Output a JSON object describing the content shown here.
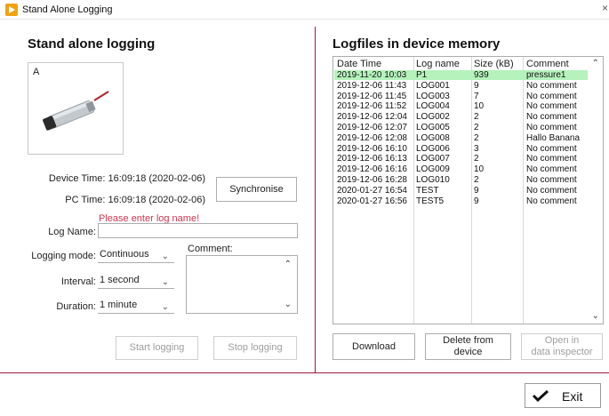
{
  "window": {
    "title": "Stand Alone Logging",
    "close_glyph": "×"
  },
  "left": {
    "heading": "Stand alone logging",
    "image_label": "A",
    "device_time": "Device Time: 16:09:18 (2020-02-06)",
    "pc_time": "PC Time: 16:09:18 (2020-02-06)",
    "sync_button": "Synchronise",
    "warning": "Please enter log name!",
    "log_name_label": "Log Name:",
    "log_name_value": "",
    "logging_mode_label": "Logging mode:",
    "logging_mode_value": "Continuous",
    "comment_label": "Comment:",
    "interval_label": "Interval:",
    "interval_value": "1 second",
    "duration_label": "Duration:",
    "duration_value": "1 minute",
    "start_button": "Start logging",
    "stop_button": "Stop logging"
  },
  "right": {
    "heading": "Logfiles in device memory",
    "columns": [
      "Date Time",
      "Log name",
      "Size (kB)",
      "Comment"
    ],
    "rows": [
      [
        "2019-11-20 10:03",
        "P1",
        "939",
        "pressure1"
      ],
      [
        "2019-12-06 11:43",
        "LOG001",
        "9",
        "No comment"
      ],
      [
        "2019-12-06 11:45",
        "LOG003",
        "7",
        "No comment"
      ],
      [
        "2019-12-06 11:52",
        "LOG004",
        "10",
        "No comment"
      ],
      [
        "2019-12-06 12:04",
        "LOG002",
        "2",
        "No comment"
      ],
      [
        "2019-12-06 12:07",
        "LOG005",
        "2",
        "No comment"
      ],
      [
        "2019-12-06 12:08",
        "LOG008",
        "2",
        "Hallo Banana"
      ],
      [
        "2019-12-06 16:10",
        "LOG006",
        "3",
        "No comment"
      ],
      [
        "2019-12-06 16:13",
        "LOG007",
        "2",
        "No comment"
      ],
      [
        "2019-12-06 16:16",
        "LOG009",
        "10",
        "No comment"
      ],
      [
        "2019-12-06 16:28",
        "LOG010",
        "2",
        "No comment"
      ],
      [
        "2020-01-27 16:54",
        "TEST",
        "9",
        "No comment"
      ],
      [
        "2020-01-27 16:56",
        "TEST5",
        "9",
        "No comment"
      ]
    ],
    "selected_row": 0,
    "download_button": "Download",
    "delete_button_line1": "Delete from",
    "delete_button_line2": "device",
    "open_button_line1": "Open in",
    "open_button_line2": "data inspector"
  },
  "footer": {
    "exit_button": "Exit"
  },
  "colors": {
    "accent_line": "#a3173b",
    "warning": "#d1334f",
    "selected_row": "#b5f2bc",
    "app_icon": "#f2a20e"
  },
  "icons": [
    "app-icon",
    "close-icon",
    "chevron-down-icon",
    "chevron-up-icon",
    "check-icon",
    "sensor-image"
  ]
}
